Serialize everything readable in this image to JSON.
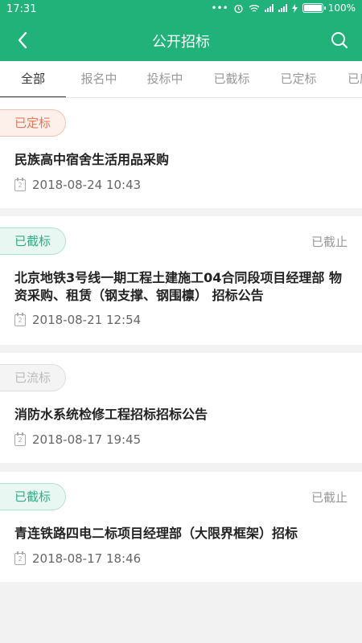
{
  "status_bar": {
    "time": "17:31",
    "dots": "•••",
    "battery_text": "100%"
  },
  "app_bar": {
    "title": "公开招标"
  },
  "tabs": [
    {
      "label": "全部"
    },
    {
      "label": "报名中"
    },
    {
      "label": "投标中"
    },
    {
      "label": "已截标"
    },
    {
      "label": "已定标"
    },
    {
      "label": "已废标"
    }
  ],
  "cards": [
    {
      "badge": "已定标",
      "status": "",
      "title": "民族高中宿舍生活用品采购",
      "date": "2018-08-24 10:43",
      "calendar_day": "2"
    },
    {
      "badge": "已截标",
      "status": "已截止",
      "title": "北京地铁3号线一期工程土建施工04合同段项目经理部 物资采购、租赁（钢支撑、钢围檩） 招标公告",
      "date": "2018-08-21 12:54",
      "calendar_day": "2"
    },
    {
      "badge": "已流标",
      "status": "",
      "title": "消防水系统检修工程招标招标公告",
      "date": "2018-08-17 19:45",
      "calendar_day": "2"
    },
    {
      "badge": "已截标",
      "status": "已截止",
      "title": "青连铁路四电二标项目经理部（大限界框架）招标",
      "date": "2018-08-17 18:46",
      "calendar_day": "2"
    }
  ],
  "colors": {
    "primary": "#21b27a",
    "badge_orange": "#e4785a",
    "badge_green": "#2fae86",
    "badge_gray": "#bbbbbb"
  }
}
